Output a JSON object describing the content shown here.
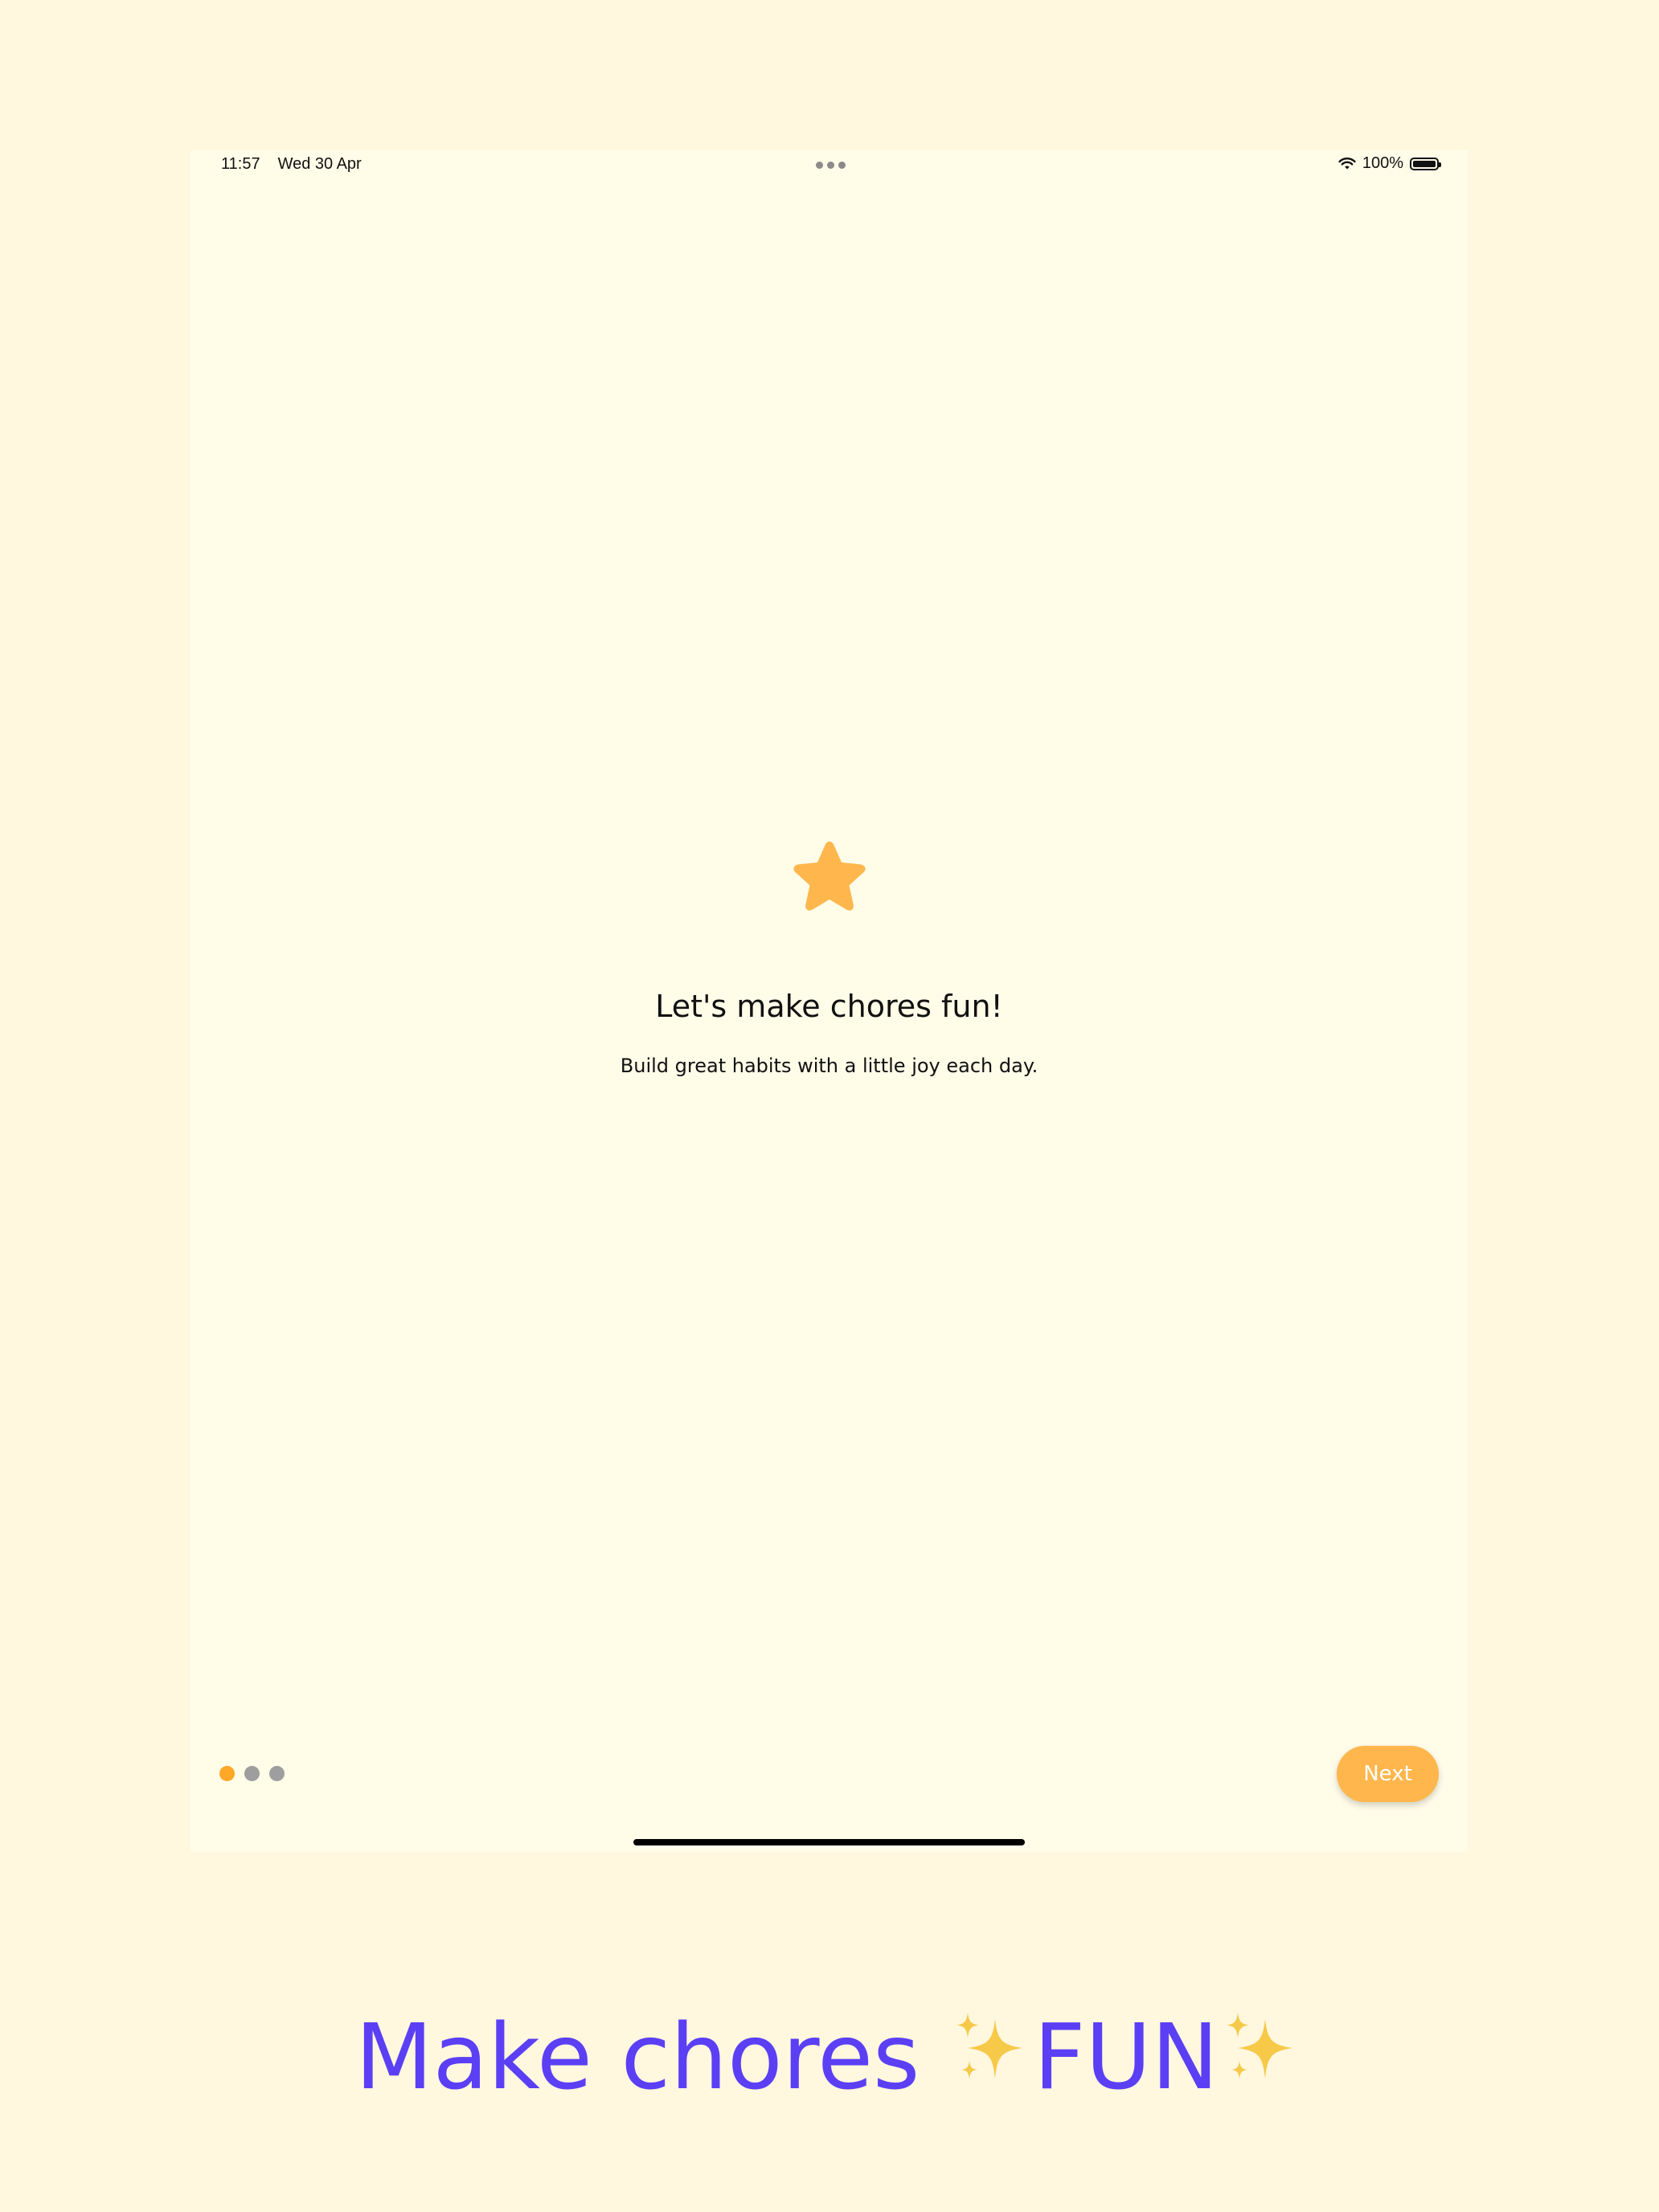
{
  "status_bar": {
    "time": "11:57",
    "date": "Wed 30 Apr",
    "battery": "100%",
    "wifi_icon": "wifi-icon",
    "battery_icon": "battery-full-icon"
  },
  "onboarding": {
    "icon": "star-icon",
    "title": "Let's make chores fun!",
    "subtitle": "Build great habits with a little joy each day.",
    "page_index": 1,
    "page_count": 3,
    "next_label": "Next"
  },
  "caption": {
    "prefix": "Make chores ",
    "highlight": "FUN",
    "sparkle_icon": "sparkles-icon"
  },
  "colors": {
    "page_background": "#FFF7DE",
    "screen_background": "#FFFCE8",
    "accent": "#FFB74D",
    "pager_active": "#FFA726",
    "pager_inactive": "#9E9E9E",
    "caption_text": "#5B3FF5",
    "sparkle": "#F7C948"
  }
}
